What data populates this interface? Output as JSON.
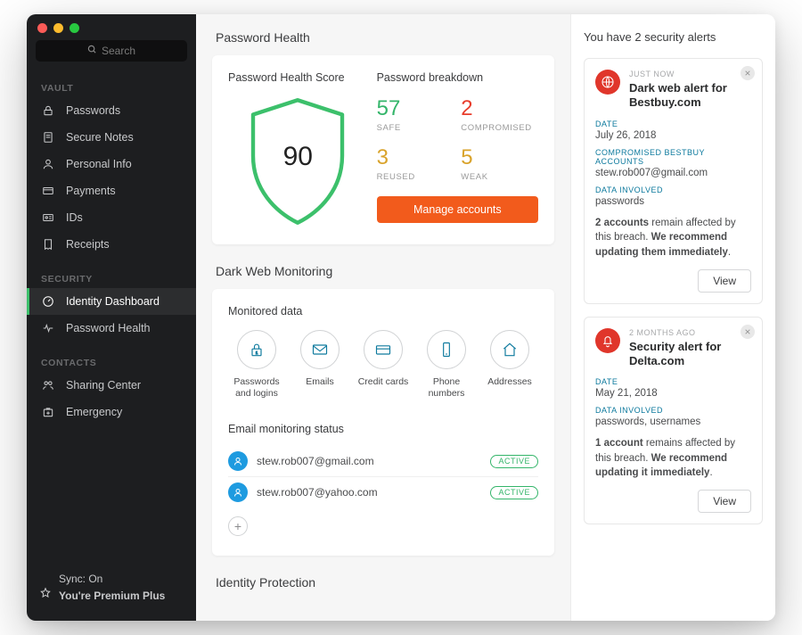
{
  "search": {
    "placeholder": "Search"
  },
  "sidebar": {
    "sections": [
      {
        "header": "VAULT",
        "items": [
          {
            "label": "Passwords"
          },
          {
            "label": "Secure Notes"
          },
          {
            "label": "Personal Info"
          },
          {
            "label": "Payments"
          },
          {
            "label": "IDs"
          },
          {
            "label": "Receipts"
          }
        ]
      },
      {
        "header": "SECURITY",
        "items": [
          {
            "label": "Identity Dashboard",
            "active": true
          },
          {
            "label": "Password Health"
          }
        ]
      },
      {
        "header": "CONTACTS",
        "items": [
          {
            "label": "Sharing Center"
          },
          {
            "label": "Emergency"
          }
        ]
      }
    ],
    "footer": {
      "sync": "Sync: On",
      "plan": "You're Premium Plus"
    }
  },
  "main": {
    "password_health": {
      "title": "Password Health",
      "score_label": "Password Health Score",
      "score": "90",
      "breakdown_label": "Password breakdown",
      "breakdown": {
        "safe": {
          "num": "57",
          "label": "SAFE"
        },
        "compromised": {
          "num": "2",
          "label": "COMPROMISED"
        },
        "reused": {
          "num": "3",
          "label": "REUSED"
        },
        "weak": {
          "num": "5",
          "label": "WEAK"
        }
      },
      "button": "Manage accounts"
    },
    "dark_web": {
      "title": "Dark Web Monitoring",
      "monitored_label": "Monitored data",
      "monitored": [
        {
          "label": "Passwords and logins"
        },
        {
          "label": "Emails"
        },
        {
          "label": "Credit cards"
        },
        {
          "label": "Phone numbers"
        },
        {
          "label": "Addresses"
        }
      ],
      "email_status_label": "Email monitoring status",
      "emails": [
        {
          "address": "stew.rob007@gmail.com",
          "status": "ACTIVE"
        },
        {
          "address": "stew.rob007@yahoo.com",
          "status": "ACTIVE"
        }
      ]
    },
    "identity_protection": {
      "title": "Identity Protection"
    }
  },
  "alerts": {
    "title": "You have 2 security alerts",
    "items": [
      {
        "when": "JUST NOW",
        "title": "Dark web alert for Bestbuy.com",
        "icon": "globe",
        "fields": [
          {
            "label": "DATE",
            "value": "July 26, 2018"
          },
          {
            "label": "COMPROMISED BESTBUY ACCOUNTS",
            "value": "stew.rob007@gmail.com"
          },
          {
            "label": "DATA INVOLVED",
            "value": "passwords"
          }
        ],
        "body_bold1": "2 accounts",
        "body_mid": " remain affected by this breach. ",
        "body_bold2": "We recommend updating them immediately",
        "view": "View"
      },
      {
        "when": "2 MONTHS AGO",
        "title": "Security alert for Delta.com",
        "icon": "bell",
        "fields": [
          {
            "label": "DATE",
            "value": "May 21, 2018"
          },
          {
            "label": "DATA INVOLVED",
            "value": "passwords, usernames"
          }
        ],
        "body_bold1": "1 account",
        "body_mid": " remains affected by this breach. ",
        "body_bold2": "We recommend updating it immediately",
        "view": "View"
      }
    ]
  }
}
